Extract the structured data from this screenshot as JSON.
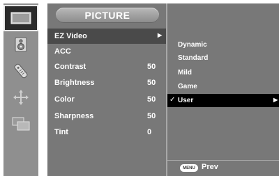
{
  "sidebar": {
    "icons": [
      {
        "name": "picture-icon",
        "selected": true
      },
      {
        "name": "audio-icon",
        "selected": false
      },
      {
        "name": "time-icon",
        "selected": false
      },
      {
        "name": "setup-icon",
        "selected": false
      },
      {
        "name": "input-icon",
        "selected": false
      }
    ]
  },
  "menu": {
    "title": "PICTURE",
    "items": [
      {
        "label": "EZ Video",
        "value": "",
        "arrow": "▶"
      },
      {
        "label": "ACC",
        "value": ""
      },
      {
        "label": "Contrast",
        "value": "50"
      },
      {
        "label": "Brightness",
        "value": "50"
      },
      {
        "label": "Color",
        "value": "50"
      },
      {
        "label": "Sharpness",
        "value": "50"
      },
      {
        "label": "Tint",
        "value": "0"
      }
    ]
  },
  "submenu": {
    "items": [
      {
        "label": "Dynamic"
      },
      {
        "label": "Standard"
      },
      {
        "label": "Mild"
      },
      {
        "label": "Game"
      },
      {
        "label": "User",
        "check": "✓",
        "arrow": "▶",
        "selected": true
      }
    ],
    "footer": {
      "key_label": "MENU",
      "action_label": "Prev"
    }
  },
  "colors": {
    "panel": "#787878",
    "sidebar": "#8f8f8f",
    "highlight": "#4a4a4a",
    "selected": "#000000",
    "text": "#ffffff"
  }
}
